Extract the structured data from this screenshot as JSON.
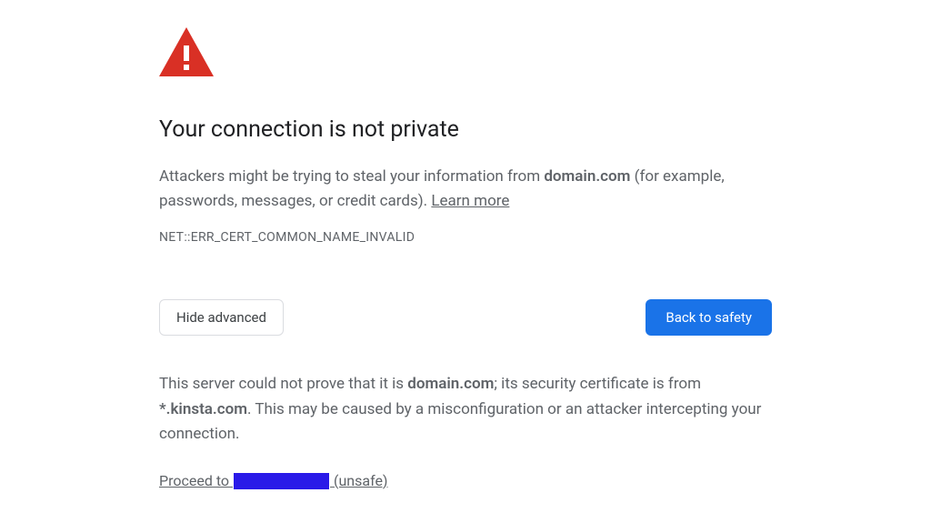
{
  "title": "Your connection is not private",
  "body": {
    "prefix": "Attackers might be trying to steal your information from ",
    "domain": "domain.com",
    "suffix": " (for example, passwords, messages, or credit cards). ",
    "learn_more": "Learn more"
  },
  "error_code": "NET::ERR_CERT_COMMON_NAME_INVALID",
  "buttons": {
    "hide_advanced": "Hide advanced",
    "back_to_safety": "Back to safety"
  },
  "advanced": {
    "prefix": "This server could not prove that it is ",
    "domain": "domain.com",
    "mid": "; its security certificate is from ",
    "cert_domain": "*.kinsta.com",
    "suffix": ". This may be caused by a misconfiguration or an attacker intercepting your connection."
  },
  "proceed": {
    "prefix": "Proceed to ",
    "unsafe": "(unsafe)"
  },
  "colors": {
    "warning_red": "#d93025",
    "primary_blue": "#1a73e8"
  }
}
